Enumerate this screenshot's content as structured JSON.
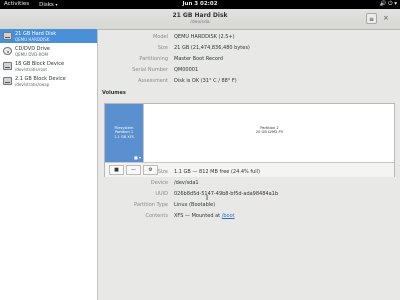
{
  "topbar": {
    "activities": "Activities",
    "app_menu": "Disks",
    "app_menu_arrow": "▾",
    "clock": "Jun 3  02:02",
    "tray_icons": "🔊 ⏻ ▾"
  },
  "header": {
    "title": "21 GB Hard Disk",
    "subtitle": "/dev/sda",
    "menu_icon": "≡",
    "close_icon": "×"
  },
  "sidebar": {
    "devices": [
      {
        "name": "21 GB Hard Disk",
        "detail": "QEMU HARDDISK",
        "icon": "hard-disk-icon",
        "selected": true
      },
      {
        "name": "CD/DVD Drive",
        "detail": "QEMU DVD-ROM",
        "icon": "optical-drive-icon",
        "selected": false
      },
      {
        "name": "18 GB Block Device",
        "detail": "/dev/stratis/root",
        "icon": "block-device-icon",
        "selected": false
      },
      {
        "name": "2.1 GB Block Device",
        "detail": "/dev/stratis/swap",
        "icon": "block-device-icon",
        "selected": false
      }
    ]
  },
  "drive": {
    "fields": [
      {
        "label": "Model",
        "value": "QEMU HARDDISK (2.5+)"
      },
      {
        "label": "Size",
        "value": "21 GB (21,474,836,480 bytes)"
      },
      {
        "label": "Partitioning",
        "value": "Master Boot Record"
      },
      {
        "label": "Serial Number",
        "value": "QM00001"
      },
      {
        "label": "Assessment",
        "value": "Disk is OK (31° C / 88° F)"
      }
    ]
  },
  "volumes": {
    "title": "Volumes",
    "partitions": [
      {
        "lines": [
          "Filesystem",
          "Partition 1",
          "1.1 GB XFS"
        ],
        "width_fraction": 0.13,
        "selected": true,
        "mark": "■ ▾"
      },
      {
        "lines": [
          "Partition 2",
          "20 GB LVM2 PV"
        ],
        "width_fraction": 0.87,
        "selected": false
      }
    ],
    "toolbar": {
      "stop": "■",
      "remove": "—",
      "settings": "⚙"
    }
  },
  "partition": {
    "fields": [
      {
        "label": "Size",
        "value": "1.1 GB — 812 MB free (24.4% full)"
      },
      {
        "label": "Device",
        "value": "/dev/sda1"
      },
      {
        "label": "UUID",
        "value": "026b8d5d-5147-49b8-bf5d-ada98484a1b"
      },
      {
        "label": "Partition Type",
        "value": "Linux (Bootable)"
      }
    ],
    "contents_label": "Contents",
    "contents_text": "XFS — Mounted at ",
    "contents_link": "/boot"
  },
  "cursor_glyph": "I"
}
